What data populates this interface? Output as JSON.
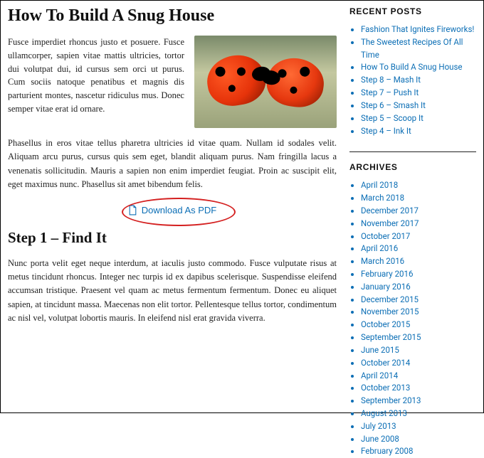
{
  "post": {
    "title": "How To Build A Snug House",
    "lead_left": "Fusce imperdiet rhoncus justo et posuere. Fusce ullamcorper, sapien vitae mattis ultricies, tortor dui volutpat dui, id cursus sem orci ut purus. Cum sociis natoque penatibus et magnis dis parturient montes, nascetur ridiculus mus. Donec semper vitae erat id ornare.",
    "para2": "Phasellus in eros vitae tellus pharetra ultricies id vitae quam. Nullam id sodales velit. Aliquam arcu purus, cursus quis sem eget, blandit aliquam purus. Nam fringilla lacus a venenatis sollicitudin. Mauris a sapien non enim imperdiet feugiat. Proin ac suscipit elit, eget maximus nunc. Phasellus sit amet bibendum felis.",
    "pdf_label": "Download As PDF",
    "step1_heading": "Step 1 – Find It",
    "step1_body": "Nunc porta velit eget neque interdum, at iaculis justo commodo. Fusce vulputate risus at metus tincidunt rhoncus. Integer nec turpis id ex dapibus scelerisque. Suspendisse eleifend accumsan tristique. Praesent vel quam ac metus fermentum fermentum. Donec eu aliquet sapien, at tincidunt massa. Maecenas non elit tortor. Pellentesque tellus tortor, condimentum ac nisl vel, volutpat lobortis mauris. In eleifend nisl erat gravida viverra."
  },
  "sidebar": {
    "recent_title": "RECENT POSTS",
    "recent": [
      "Fashion That Ignites Fireworks!",
      "The Sweetest Recipes Of All Time",
      "How To Build A Snug House",
      "Step 8 – Mash It",
      "Step 7 – Push It",
      "Step 6 – Smash It",
      "Step 5 – Scoop It",
      "Step 4 – Ink It"
    ],
    "archives_title": "ARCHIVES",
    "archives": [
      "April 2018",
      "March 2018",
      "December 2017",
      "November 2017",
      "October 2017",
      "April 2016",
      "March 2016",
      "February 2016",
      "January 2016",
      "December 2015",
      "November 2015",
      "October 2015",
      "September 2015",
      "June 2015",
      "October 2014",
      "April 2014",
      "October 2013",
      "September 2013",
      "August 2013",
      "July 2013",
      "June 2008",
      "February 2008"
    ]
  }
}
